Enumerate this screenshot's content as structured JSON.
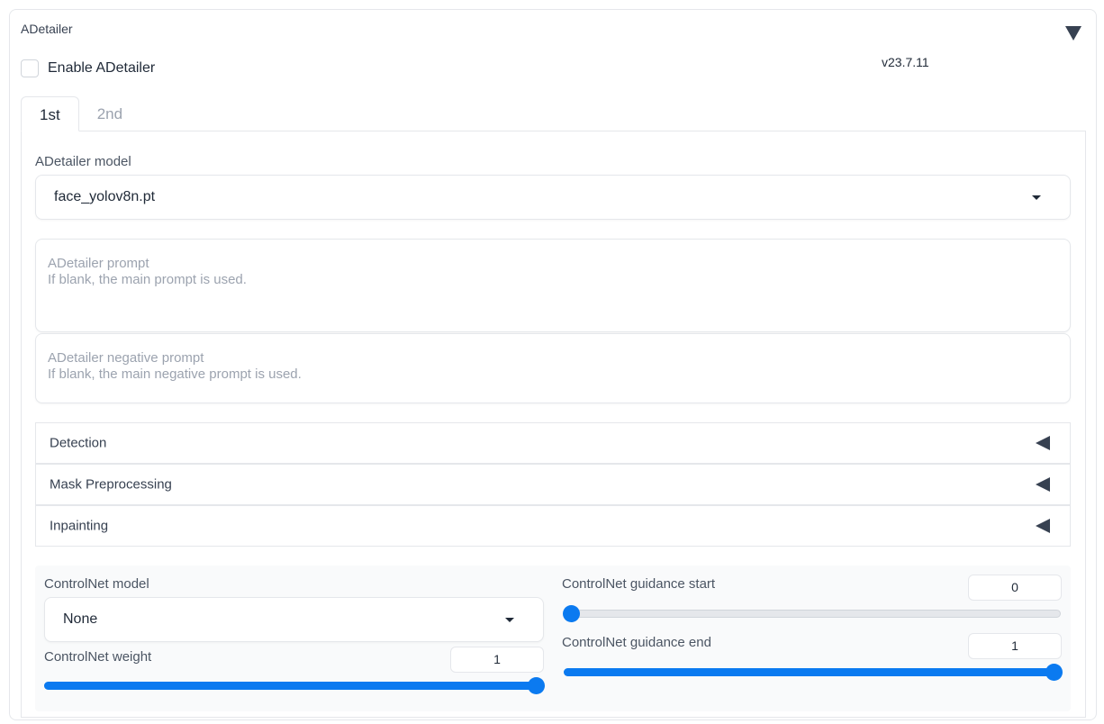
{
  "panel": {
    "title": "ADetailer"
  },
  "enable": {
    "label": "Enable ADetailer",
    "checked": false
  },
  "version": "v23.7.11",
  "tabs": [
    {
      "label": "1st",
      "active": true
    },
    {
      "label": "2nd",
      "active": false
    }
  ],
  "model": {
    "label": "ADetailer model",
    "value": "face_yolov8n.pt"
  },
  "prompt": {
    "placeholder": "ADetailer prompt\nIf blank, the main prompt is used."
  },
  "negative_prompt": {
    "placeholder": "ADetailer negative prompt\nIf blank, the main negative prompt is used."
  },
  "accordions": [
    {
      "label": "Detection"
    },
    {
      "label": "Mask Preprocessing"
    },
    {
      "label": "Inpainting"
    }
  ],
  "controlnet": {
    "model_label": "ControlNet model",
    "model_value": "None",
    "weight_label": "ControlNet weight",
    "weight_value": "1",
    "weight_fraction": 1.0,
    "start_label": "ControlNet guidance start",
    "start_value": "0",
    "start_fraction": 0.0,
    "end_label": "ControlNet guidance end",
    "end_value": "1",
    "end_fraction": 1.0
  },
  "colors": {
    "accent": "#0b7af0",
    "border": "#e5e7eb"
  }
}
